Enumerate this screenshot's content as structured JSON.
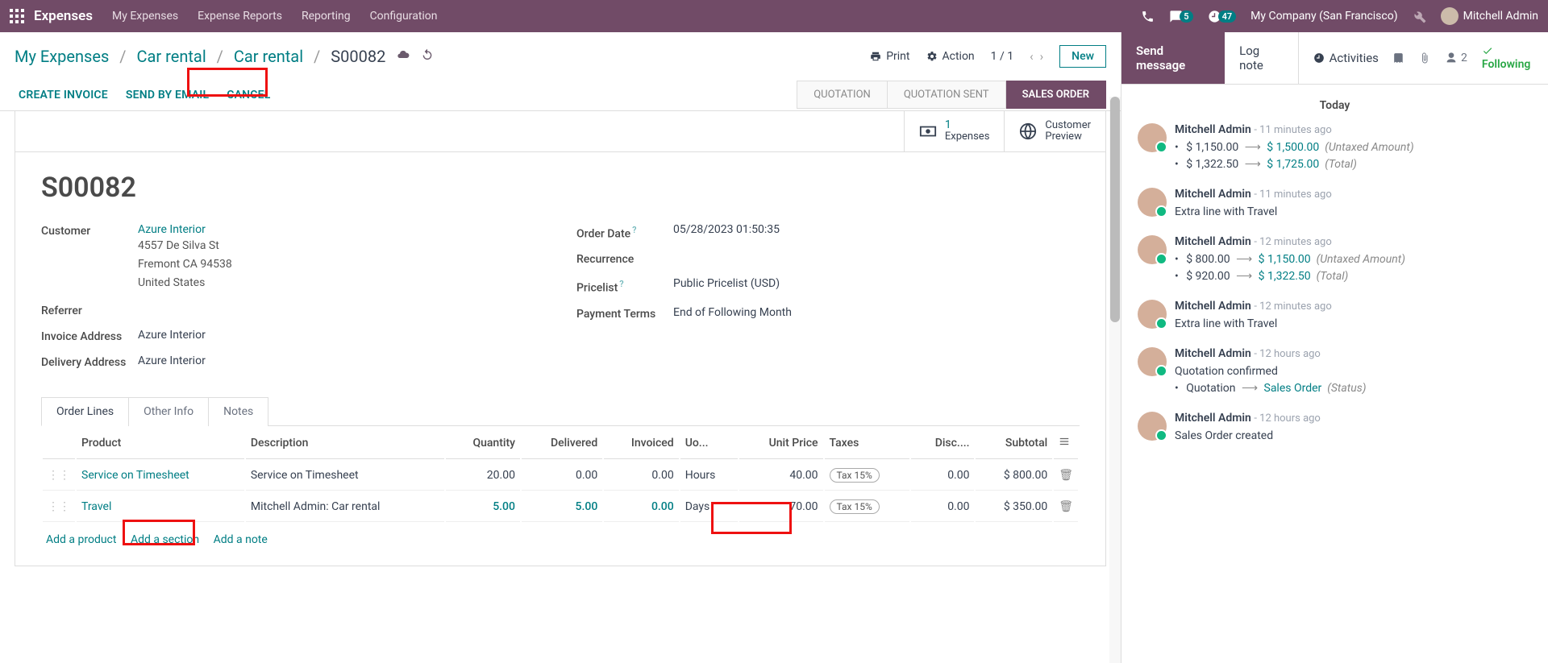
{
  "topnav": {
    "brand": "Expenses",
    "menu": [
      "My Expenses",
      "Expense Reports",
      "Reporting",
      "Configuration"
    ],
    "chat_count": "5",
    "clock_count": "47",
    "company": "My Company (San Francisco)",
    "user": "Mitchell Admin"
  },
  "breadcrumb": {
    "p1": "My Expenses",
    "p2": "Car rental",
    "p3": "Car rental",
    "p4": "S00082",
    "print": "Print",
    "action": "Action",
    "pager": "1 / 1",
    "new": "New"
  },
  "actions": {
    "invoice": "CREATE INVOICE",
    "email": "SEND BY EMAIL",
    "cancel": "CANCEL",
    "statuses": [
      "QUOTATION",
      "QUOTATION SENT",
      "SALES ORDER"
    ]
  },
  "stats": {
    "expenses_n": "1",
    "expenses_l": "Expenses",
    "preview_t": "Customer",
    "preview_b": "Preview"
  },
  "order": {
    "number": "S00082",
    "customer_label": "Customer",
    "customer": "Azure Interior",
    "addr1": "4557 De Silva St",
    "addr2": "Fremont CA 94538",
    "addr3": "United States",
    "referrer_label": "Referrer",
    "inv_addr_label": "Invoice Address",
    "inv_addr": "Azure Interior",
    "del_addr_label": "Delivery Address",
    "del_addr": "Azure Interior",
    "orderdate_label": "Order Date",
    "orderdate": "05/28/2023 01:50:35",
    "recurrence_label": "Recurrence",
    "pricelist_label": "Pricelist",
    "pricelist": "Public Pricelist (USD)",
    "payterms_label": "Payment Terms",
    "payterms": "End of Following Month"
  },
  "tabs": [
    "Order Lines",
    "Other Info",
    "Notes"
  ],
  "table": {
    "headers": {
      "product": "Product",
      "description": "Description",
      "quantity": "Quantity",
      "delivered": "Delivered",
      "invoiced": "Invoiced",
      "uom": "Uo...",
      "unit_price": "Unit Price",
      "taxes": "Taxes",
      "disc": "Disc....",
      "subtotal": "Subtotal"
    },
    "rows": [
      {
        "product": "Service on Timesheet",
        "desc": "Service on Timesheet",
        "qty": "20.00",
        "delivered": "0.00",
        "invoiced": "0.00",
        "uom": "Hours",
        "price": "40.00",
        "tax": "Tax 15%",
        "disc": "0.00",
        "subtotal": "$ 800.00",
        "hl_qty": false
      },
      {
        "product": "Travel",
        "desc": "Mitchell Admin: Car rental",
        "qty": "5.00",
        "delivered": "5.00",
        "invoiced": "0.00",
        "uom": "Days",
        "price": "70.00",
        "tax": "Tax 15%",
        "disc": "0.00",
        "subtotal": "$ 350.00",
        "hl_qty": true
      }
    ],
    "add_product": "Add a product",
    "add_section": "Add a section",
    "add_note": "Add a note"
  },
  "chatter": {
    "send": "Send message",
    "log": "Log note",
    "activities": "Activities",
    "followers": "2",
    "following": "Following",
    "today": "Today",
    "msgs": [
      {
        "author": "Mitchell Admin",
        "time": "- 11 minutes ago",
        "lines": [
          {
            "type": "change",
            "old": "$ 1,150.00",
            "new": "$ 1,500.00",
            "tag": "(Untaxed Amount)"
          },
          {
            "type": "change",
            "old": "$ 1,322.50",
            "new": "$ 1,725.00",
            "tag": "(Total)"
          }
        ]
      },
      {
        "author": "Mitchell Admin",
        "time": "- 11 minutes ago",
        "lines": [
          {
            "type": "text",
            "text": "Extra line with Travel"
          }
        ]
      },
      {
        "author": "Mitchell Admin",
        "time": "- 12 minutes ago",
        "lines": [
          {
            "type": "change",
            "old": "$ 800.00",
            "new": "$ 1,150.00",
            "tag": "(Untaxed Amount)"
          },
          {
            "type": "change",
            "old": "$ 920.00",
            "new": "$ 1,322.50",
            "tag": "(Total)"
          }
        ]
      },
      {
        "author": "Mitchell Admin",
        "time": "- 12 minutes ago",
        "lines": [
          {
            "type": "text",
            "text": "Extra line with Travel"
          }
        ]
      },
      {
        "author": "Mitchell Admin",
        "time": "- 12 hours ago",
        "lines": [
          {
            "type": "text",
            "text": "Quotation confirmed"
          },
          {
            "type": "change",
            "old": "Quotation",
            "new": "Sales Order",
            "tag": "(Status)"
          }
        ]
      },
      {
        "author": "Mitchell Admin",
        "time": "- 12 hours ago",
        "lines": [
          {
            "type": "text",
            "text": "Sales Order created"
          }
        ]
      }
    ]
  }
}
